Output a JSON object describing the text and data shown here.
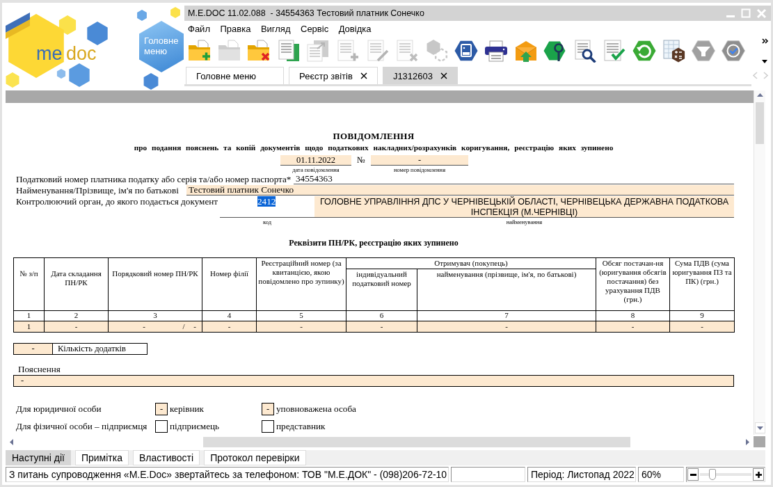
{
  "logo": {
    "words": [
      "me",
      "doc"
    ]
  },
  "main_menu_tile": {
    "label": "Головне меню"
  },
  "window": {
    "title": "M.E.DOC 11.02.088  - 34554363 Тестовий платник Сонечко"
  },
  "menu": [
    "Файл",
    "Правка",
    "Вигляд",
    "Сервіс",
    "Довідка"
  ],
  "toolbar": [
    {
      "kind": "folder-plus",
      "disabled": false
    },
    {
      "kind": "folder",
      "disabled": true
    },
    {
      "kind": "folder-cross",
      "disabled": false
    },
    {
      "kind": "document-copy",
      "disabled": false
    },
    {
      "kind": "documents",
      "disabled": true
    },
    {
      "kind": "document-plus",
      "disabled": true
    },
    {
      "kind": "document-pencil",
      "disabled": true
    },
    {
      "kind": "document-cross",
      "disabled": true
    },
    {
      "kind": "hexagons",
      "disabled": true
    },
    {
      "kind": "hexagon-card",
      "disabled": false
    },
    {
      "kind": "printer",
      "disabled": false
    },
    {
      "kind": "envelope",
      "disabled": false
    },
    {
      "kind": "hexagon-magnifier",
      "disabled": false
    },
    {
      "kind": "document-magnifier",
      "disabled": false
    },
    {
      "kind": "document-check",
      "disabled": false
    },
    {
      "kind": "hexagon-refresh",
      "disabled": false
    },
    {
      "kind": "table-calculator",
      "disabled": false
    },
    {
      "kind": "hexagon-funnel",
      "disabled": false
    },
    {
      "kind": "hexagon-check",
      "disabled": false
    }
  ],
  "tabs": [
    {
      "label": "Головне меню",
      "selected": false,
      "closable": false
    },
    {
      "label": "Реєстр звітів",
      "selected": false,
      "closable": true
    },
    {
      "label": "J1312603",
      "selected": true,
      "closable": true
    }
  ],
  "document": {
    "title": "ПОВІДОМЛЕННЯ",
    "subtitle": "про подання пояснень та копій документів щодо податкових накладних/розрахунків коригування, реєстрацію яких зупинено",
    "date": {
      "value": "01.11.2022",
      "caption": "дата повідомлення"
    },
    "number_sign": "№",
    "number": {
      "value": "-",
      "caption": "номер повідомлення"
    },
    "taxpayer_id": {
      "label": "Податковий номер платника податку або серія та/або номер паспорта*",
      "value": "34554363"
    },
    "taxpayer_name": {
      "label": "Найменування/Прізвище, ім'я по батькові",
      "value": "Тестовий платник Сонечко"
    },
    "authority": {
      "label": "Контролюючий орган, до якого подається документ",
      "code": {
        "value": "2412",
        "caption": "код",
        "highlighted": true
      },
      "name": {
        "value": "ГОЛОВНЕ УПРАВЛІННЯ ДПС У ЧЕРНІВЕЦЬКІЙ ОБЛАСТІ, ЧЕРНІВЕЦЬКА ДЕРЖАВНА ПОДАТКОВА ІНСПЕКЦІЯ (М.ЧЕРНІВЦІ)",
        "caption": "найменування"
      }
    },
    "table": {
      "title": "Реквізити ПН/РК, реєстрацію яких зупинено",
      "columns": [
        {
          "header": "№ з/п"
        },
        {
          "header": "Дата складання ПН/РК"
        },
        {
          "header": "Порядковий номер ПН/РК"
        },
        {
          "header": "Номер філії"
        },
        {
          "header": "Реєстраційний номер (за квитанцією, якою повідомлено про зупинку)"
        },
        {
          "header": "Отримувач (покупець)",
          "colspan": 2,
          "subcolumns": [
            {
              "header": "індивідуальний податковий номер"
            },
            {
              "header": "найменування (прізвище, ім'я, по батькові)"
            }
          ]
        },
        {
          "header": "Обсяг постачан-ня (юригування обсягів постачання) без урахування ПДВ (грн.)"
        },
        {
          "header": "Сума ПДВ (сума юригування ПЗ та ПК) (грн.)"
        }
      ],
      "numbers": [
        "1",
        "2",
        "3",
        "4",
        "5",
        "6",
        "7",
        "8",
        "9"
      ],
      "rows": [
        {
          "cells": [
            "1",
            "-",
            [
              "-",
              "/",
              "-"
            ],
            "-",
            "-",
            "-",
            "-",
            "-",
            "-"
          ]
        }
      ]
    },
    "attachments": {
      "value": "-",
      "label": "Кількість додатків"
    },
    "explanation": {
      "label": "Пояснення",
      "value": "-"
    },
    "signatories": [
      {
        "label": "Для юридичної особи",
        "options": [
          {
            "value": "-",
            "label": "керівник"
          },
          {
            "value": "-",
            "label": "уповноважена особа"
          }
        ]
      },
      {
        "label": "Для фізичної особи – підприємця",
        "options": [
          {
            "label": "підприємець"
          },
          {
            "label": "представник"
          }
        ]
      }
    ]
  },
  "bottom_tabs": [
    {
      "label": "Наступні дії",
      "selected": true
    },
    {
      "label": "Примітка",
      "selected": false
    },
    {
      "label": "Властивості",
      "selected": false
    },
    {
      "label": "Протокол перевірки",
      "selected": false
    }
  ],
  "status_bar": {
    "message": "З питань супроводження «M.E.Doc» звертайтесь за телефоном: ТОВ \"М.Е.ДОК\" - (098)206-72-10",
    "period": "Період: Листопад 2022",
    "zoom": "60%",
    "zoom_slider": {
      "level": 0.2
    }
  }
}
